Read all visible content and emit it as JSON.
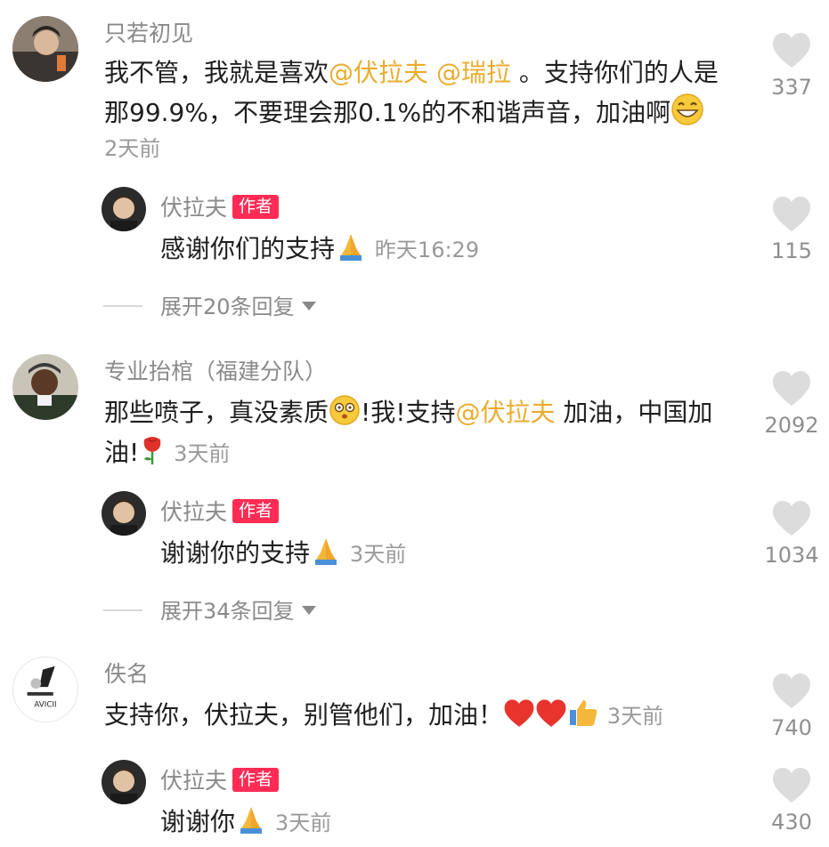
{
  "comments": [
    {
      "user": "只若初见",
      "text_pre": "我不管，我就是喜欢",
      "mention1": "@伏拉夫",
      "mention2": "@瑞拉",
      "text_post_line1": " 。支持你们的人是",
      "text_line2": "那99.9%，不要理会那0.1%的不和谐声音，加油啊",
      "time": "2天前",
      "likes": "337",
      "reply": {
        "user": "伏拉夫",
        "tag": "作者",
        "text": "感谢你们的支持",
        "time": "昨天16:29",
        "likes": "115"
      },
      "expand": "展开20条回复"
    },
    {
      "user": "专业抬棺（福建分队）",
      "text_pre": "那些喷子，真没素质",
      "text_mid": "!我!支持",
      "mention1": "@伏拉夫",
      "text_post_line1": " 加油，中国加",
      "text_line2": "油!",
      "time": "3天前",
      "likes": "2092",
      "reply": {
        "user": "伏拉夫",
        "tag": "作者",
        "text": "谢谢你的支持",
        "time": "3天前",
        "likes": "1034"
      },
      "expand": "展开34条回复"
    },
    {
      "user": "佚名",
      "text": "支持你，伏拉夫，别管他们，加油！",
      "time": "3天前",
      "likes": "740",
      "reply": {
        "user": "伏拉夫",
        "tag": "作者",
        "text": "谢谢你",
        "time": "3天前",
        "likes": "430"
      }
    }
  ],
  "colors": {
    "mention": "#e9ad2f",
    "author_tag": "#fe2c55",
    "heart": "#dcdcdc"
  }
}
